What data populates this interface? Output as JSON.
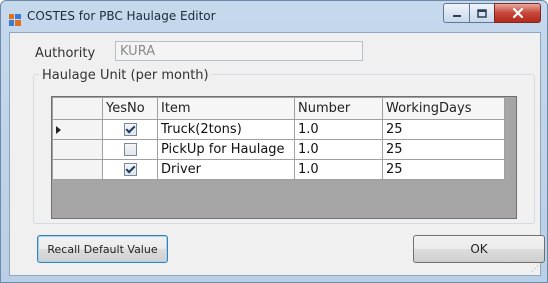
{
  "window": {
    "title": "COSTES for PBC Haulage Editor"
  },
  "authority": {
    "label": "Authority",
    "value": "KURA"
  },
  "haulage_group": {
    "label": "Haulage Unit (per month)"
  },
  "grid": {
    "columns": [
      "YesNo",
      "Item",
      "Number",
      "WorkingDays"
    ],
    "rows": [
      {
        "current": true,
        "yesno": true,
        "item": "Truck(2tons)",
        "number": "1.0",
        "working_days": "25"
      },
      {
        "current": false,
        "yesno": false,
        "item": "PickUp for Haulage",
        "number": "1.0",
        "working_days": "25"
      },
      {
        "current": false,
        "yesno": true,
        "item": "Driver",
        "number": "1.0",
        "working_days": "25"
      }
    ]
  },
  "buttons": {
    "recall_label": "Recall Default Value",
    "ok_label": "OK"
  },
  "icons": {
    "app": "app-window-icon",
    "minimize": "minimize-icon",
    "maximize": "maximize-icon",
    "close": "close-icon",
    "row_pointer": "row-pointer-icon",
    "resize_grip": "resize-grip-icon"
  },
  "colors": {
    "title_bar": "#c6d8ec",
    "close_button": "#c7453a",
    "grid_background": "#a6a6a6"
  }
}
